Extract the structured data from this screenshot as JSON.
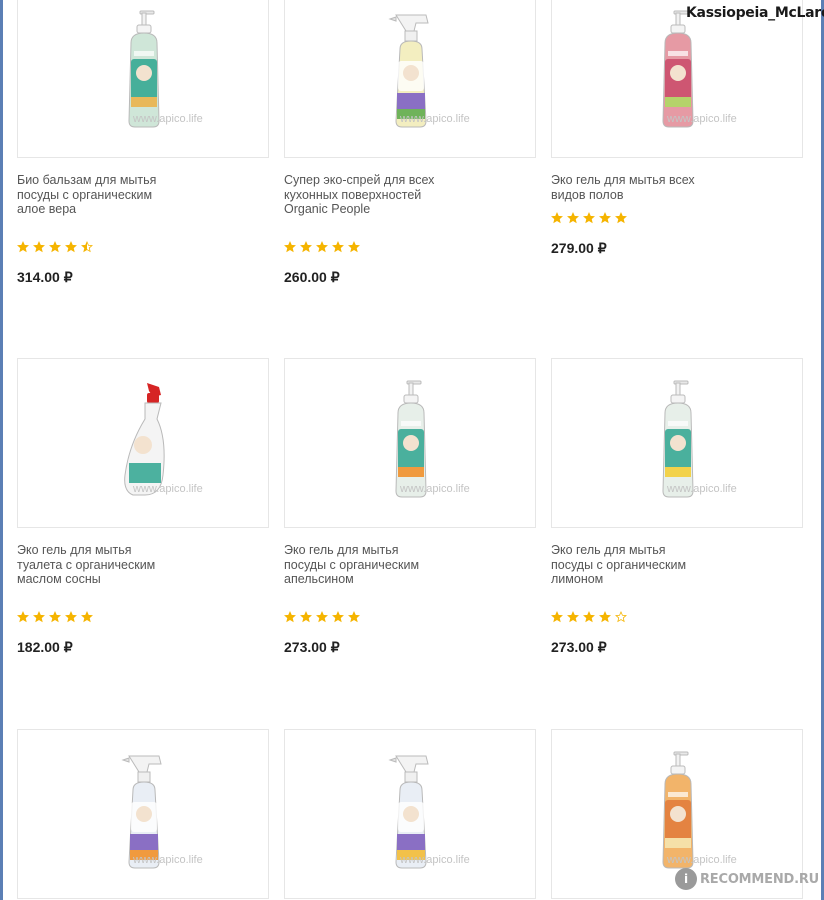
{
  "header": {
    "username": "Kassiopeia_McLaren"
  },
  "watermark_text": "www.apico.life",
  "colors": {
    "star": "#f5b400",
    "star_empty": "#d9d9d9",
    "frame": "#5b7fb5",
    "price": "#222222"
  },
  "products": [
    {
      "title": "Био бальзам для мытья посуды с органическим алое вера",
      "rating": 4.5,
      "price": "314.00 ₽",
      "bottle": {
        "type": "pump",
        "body": "#cfe6d8",
        "label": "#2ea58f",
        "accent": "#e8b85a"
      }
    },
    {
      "title": "Супер эко-спрей для всех кухонных поверхностей Organic People",
      "rating": 5,
      "price": "260.00 ₽",
      "bottle": {
        "type": "spray",
        "body": "#f3eec0",
        "label": "#8a6fc4",
        "accent": "#6fb35a"
      }
    },
    {
      "title": "Эко гель для мытья всех видов полов",
      "rating": 5,
      "price": "279.00 ₽",
      "bottle": {
        "type": "pump",
        "body": "#e69aa4",
        "label": "#c94a6a",
        "accent": "#b5d36a"
      }
    },
    {
      "title": "Эко гель для мытья туалета с органическим маслом сосны",
      "rating": 5,
      "price": "182.00 ₽",
      "bottle": {
        "type": "toilet",
        "body": "#f4f4f4",
        "label": "#2ea58f",
        "accent": "#d62424"
      }
    },
    {
      "title": "Эко гель для мытья посуды с органическим апельсином",
      "rating": 5,
      "price": "273.00 ₽",
      "bottle": {
        "type": "pump",
        "body": "#e7efe9",
        "label": "#2ea58f",
        "accent": "#f09a3e"
      }
    },
    {
      "title": "Эко гель для мытья посуды с органическим лимоном",
      "rating": 4,
      "price": "273.00 ₽",
      "bottle": {
        "type": "pump",
        "body": "#e7efe9",
        "label": "#2ea58f",
        "accent": "#f2d24a"
      }
    },
    {
      "title": "",
      "rating": null,
      "price": "",
      "bottle": {
        "type": "spray",
        "body": "#e9eef5",
        "label": "#8a6fc4",
        "accent": "#f09a3e"
      }
    },
    {
      "title": "",
      "rating": null,
      "price": "",
      "bottle": {
        "type": "spray",
        "body": "#e9eef5",
        "label": "#8a6fc4",
        "accent": "#f2c14a"
      }
    },
    {
      "title": "",
      "rating": null,
      "price": "",
      "bottle": {
        "type": "pump",
        "body": "#f2b46a",
        "label": "#e27a3a",
        "accent": "#f5e0a8"
      }
    }
  ],
  "footer": {
    "site_logo": "RECOMMEND.RU",
    "logo_mark": "i"
  }
}
